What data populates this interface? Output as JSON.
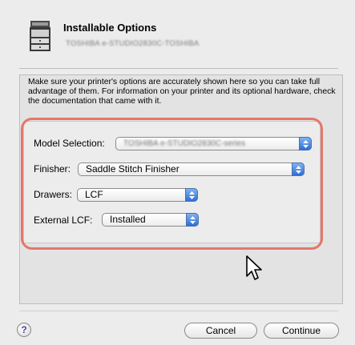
{
  "header": {
    "title": "Installable Options",
    "subtitle": "TOSHIBA e-STUDIO2830C-TOSHIBA"
  },
  "description": "Make sure your printer's options are accurately shown here so you can take full advantage of them.  For information on your printer and its optional hardware, check the documentation that came with it.",
  "options": {
    "model_selection": {
      "label": "Model Selection:",
      "value": "TOSHIBA e-STUDIO2830C-series"
    },
    "finisher": {
      "label": "Finisher:",
      "value": "Saddle Stitch Finisher"
    },
    "drawers": {
      "label": "Drawers:",
      "value": "LCF"
    },
    "external_lcf": {
      "label": "External LCF:",
      "value": "Installed"
    }
  },
  "buttons": {
    "help": "?",
    "cancel": "Cancel",
    "continue": "Continue"
  },
  "colors": {
    "highlight": "#e4776a",
    "popup_arrow": "#2f6fd6"
  },
  "icons": [
    "printer-icon",
    "mouse-cursor-icon",
    "help-icon",
    "popup-arrows-icon"
  ]
}
